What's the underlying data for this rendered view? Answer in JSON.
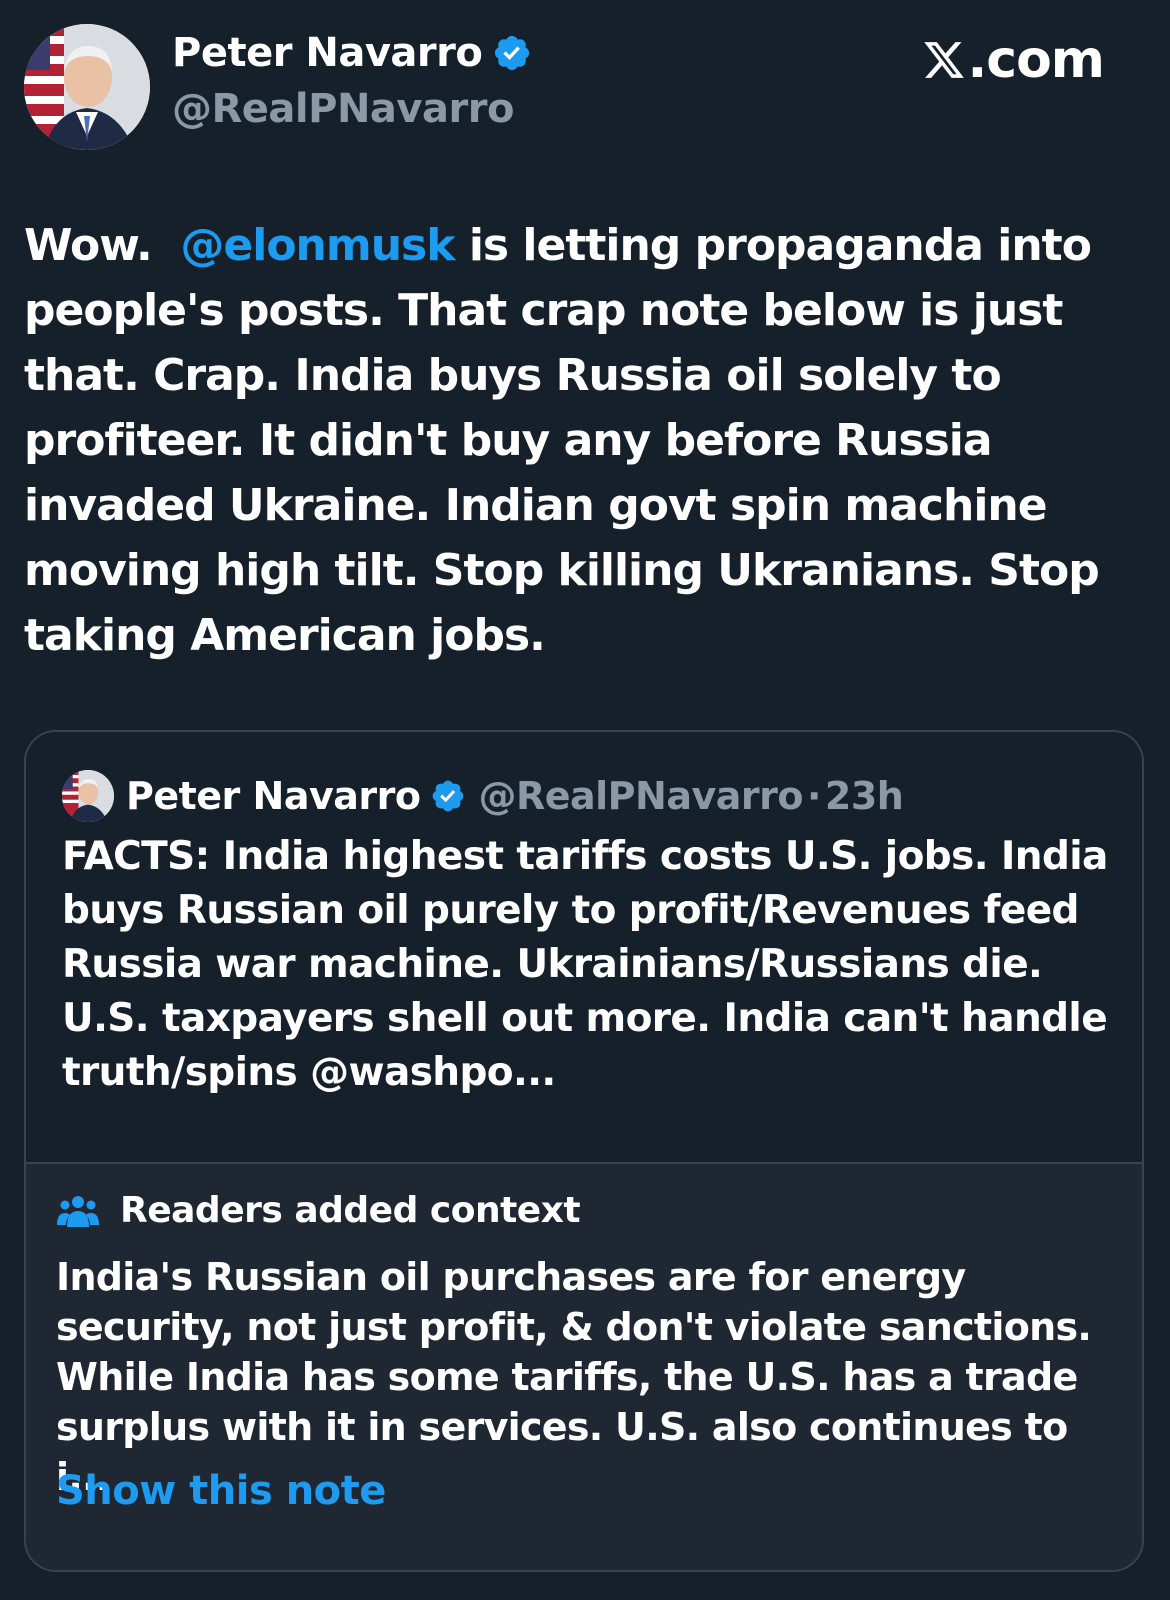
{
  "brand": {
    "site": ".com"
  },
  "author": {
    "name": "Peter Navarro",
    "handle": "@RealPNavarro"
  },
  "tweet": {
    "intro": "Wow.",
    "mention": "@elonmusk",
    "body": " is letting propaganda into people's posts.  That crap note below is just that.  Crap.  India buys Russia oil solely to profiteer.  It didn't buy any before Russia invaded Ukraine.  Indian govt spin machine moving high tilt.  Stop killing Ukranians.  Stop taking American jobs."
  },
  "quote": {
    "name": "Peter Navarro",
    "handle": "@RealPNavarro",
    "separator": "·",
    "time": "23h",
    "text": "FACTS: India highest tariffs costs U.S. jobs.  India buys Russian oil purely to profit/Revenues feed Russia war machine.  Ukrainians/Russians die.  U.S. taxpayers shell out more.  India can't handle truth/spins @washpo..."
  },
  "context": {
    "title": "Readers added context",
    "text": "India's Russian oil purchases are for energy security, not just profit, & don't violate sanctions. While India has some tariffs, the U.S. has a trade surplus with it in services. U.S. also continues to i...",
    "link": "Show this note"
  },
  "colors": {
    "background": "#15202b",
    "accent": "#1d9bf0",
    "muted": "#8b98a5",
    "border": "#38444d"
  },
  "icons": [
    "verified-badge-icon",
    "x-logo-icon",
    "people-icon"
  ]
}
